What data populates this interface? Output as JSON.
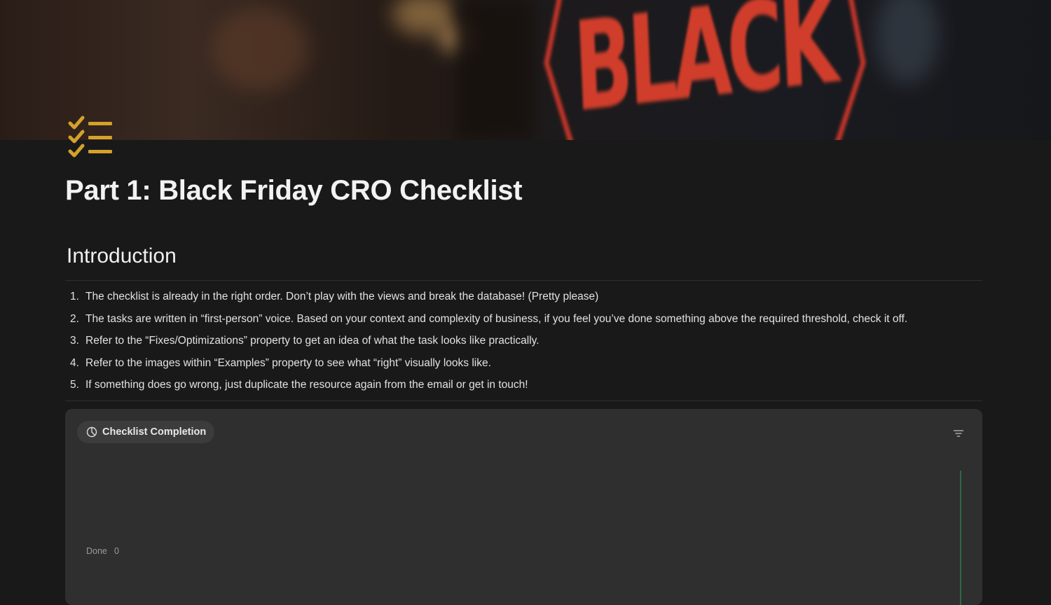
{
  "page": {
    "title": "Part 1: Black Friday CRO Checklist",
    "icon": "checklist-icon",
    "cover": {
      "sign_text": "BLACK"
    }
  },
  "introduction": {
    "heading": "Introduction",
    "items": [
      {
        "number": "1.",
        "text": "The checklist is already in the right order. Don’t play with the views and break the database! (Pretty please)"
      },
      {
        "number": "2.",
        "text": "The tasks are written in “first-person” voice. Based on your context and complexity of business, if you feel you’ve done something above the required threshold, check it off."
      },
      {
        "number": "3.",
        "text": "Refer to the “Fixes/Optimizations” property to get an idea of what the task looks like practically."
      },
      {
        "number": "4.",
        "text": "Refer to the images within “Examples” property to see what “right” visually looks like."
      },
      {
        "number": "5.",
        "text": "If something does go wrong, just duplicate the resource again from the email or get in touch!"
      }
    ]
  },
  "chart_view": {
    "name": "Checklist Completion",
    "view_icon": "pie-chart-icon",
    "filter_icon": "filter-icon"
  },
  "chart_data": {
    "type": "bar",
    "orientation": "horizontal",
    "categories": [
      "Done"
    ],
    "values": [
      0
    ],
    "value_labels": [
      "0"
    ],
    "grid": false,
    "legend": "none"
  },
  "colors": {
    "background": "#191919",
    "card": "#2f2f2f",
    "icon_accent": "#d4a12a",
    "axis_line": "#2e8b57",
    "cover_sign_red": "#e0412d"
  }
}
